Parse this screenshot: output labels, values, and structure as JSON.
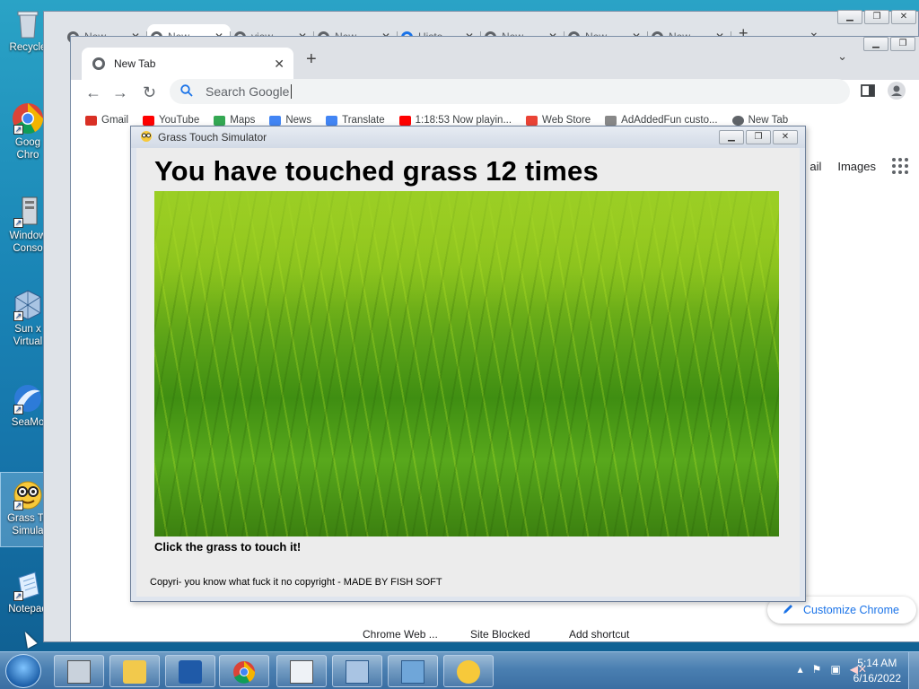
{
  "desktop": {
    "icons": [
      {
        "label": "Recycle"
      },
      {
        "label": "Goog\nChro"
      },
      {
        "label": "Window\nConso"
      },
      {
        "label": "Sun x\nVirtual"
      },
      {
        "label": "SeaMo"
      },
      {
        "label": "Grass To\nSimula"
      },
      {
        "label": "Notepad"
      }
    ]
  },
  "back_window": {
    "tabs": [
      "New",
      "New",
      "view-",
      "New",
      "Histo",
      "New",
      "New",
      "New"
    ],
    "new_tab_symbol": "+",
    "menu_symbol": "⌄"
  },
  "browser": {
    "tab_title": "New Tab",
    "close_symbol": "✕",
    "new_tab_symbol": "+",
    "search_placeholder": "Search Google",
    "bookmarks": [
      {
        "label": "Gmail",
        "color": "#d93025"
      },
      {
        "label": "YouTube",
        "color": "#ff0000"
      },
      {
        "label": "Maps",
        "color": "#34a853"
      },
      {
        "label": "News",
        "color": "#4285f4"
      },
      {
        "label": "Translate",
        "color": "#4285f4"
      },
      {
        "label": "1:18:53 Now playin...",
        "color": "#ff0000"
      },
      {
        "label": "Web Store",
        "color": "#ea4335"
      },
      {
        "label": "AdAddedFun custo...",
        "color": "#888888"
      },
      {
        "label": "New Tab",
        "color": "#5f6368"
      }
    ],
    "google_links": {
      "gmail": "ail",
      "images": "Images"
    },
    "shortcuts": [
      "Chrome Web ...",
      "Site Blocked",
      "Add shortcut"
    ],
    "customize_label": "Customize Chrome"
  },
  "grass_app": {
    "title": "Grass Touch Simulator",
    "counter_text": "You have touched grass 12 times",
    "touch_count": 12,
    "hint": "Click the grass to touch it!",
    "copyright": "Copyri- you know what fuck it no copyright - MADE BY FISH SOFT"
  },
  "taskbar": {
    "time": "5:14 AM",
    "date": "6/16/2022"
  },
  "colors": {
    "accent": "#1a73e8",
    "grass": "#5da418"
  }
}
